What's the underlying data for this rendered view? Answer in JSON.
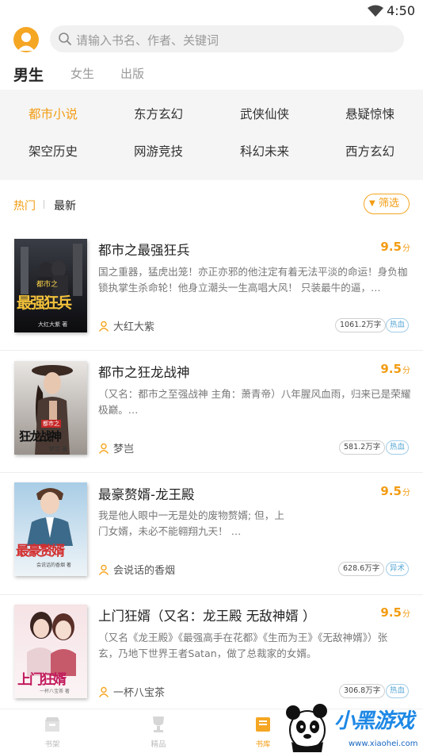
{
  "status_bar": {
    "time": "4:50"
  },
  "search": {
    "placeholder": "请输入书名、作者、关键词"
  },
  "gender_tabs": [
    {
      "label": "男生",
      "active": true
    },
    {
      "label": "女生",
      "active": false
    },
    {
      "label": "出版",
      "active": false
    }
  ],
  "categories": [
    {
      "label": "都市小说",
      "active": true
    },
    {
      "label": "东方玄幻"
    },
    {
      "label": "武侠仙侠"
    },
    {
      "label": "悬疑惊悚"
    },
    {
      "label": "架空历史"
    },
    {
      "label": "网游竞技"
    },
    {
      "label": "科幻未来"
    },
    {
      "label": "西方玄幻"
    }
  ],
  "filter": {
    "hot": "热门",
    "new": "最新",
    "button": "筛选"
  },
  "books": [
    {
      "title": "都市之最强狂兵",
      "score": "9.5",
      "score_unit": "分",
      "desc": "国之重器，猛虎出笼！亦正亦邪的他注定有着无法平淡的命运！身负枷锁执掌生杀命轮！他身立潮头一生高唱大风！ 只装最牛的逼，…",
      "author": "大红大紫",
      "word_count": "1061.2万字",
      "tag": "热血",
      "cover_text": "最强狂兵",
      "cover_top": "都市之",
      "cover_author": "大红大紫 著"
    },
    {
      "title": "都市之狂龙战神",
      "score": "9.5",
      "score_unit": "分",
      "desc": "（又名：都市之至强战神 主角：萧青帝）八年腥风血雨，归来已是荣耀极巅。…",
      "author": "梦岂",
      "word_count": "581.2万字",
      "tag": "热血",
      "cover_text": "狂龙战神",
      "cover_top": "都市之",
      "cover_author": "梦岂 著"
    },
    {
      "title": "最豪赘婿-龙王殿",
      "score": "9.5",
      "score_unit": "分",
      "desc": "我是他人眼中一无是处的废物赘婿; 但，上门女婿，未必不能翱翔九天！ …",
      "author": "会说话的香烟",
      "word_count": "628.6万字",
      "tag": "异术",
      "cover_text": "最豪赘婿",
      "cover_top": "",
      "cover_author": "会说话的香烟 著"
    },
    {
      "title": "上门狂婿（又名：龙王殿 无敌神婿 ）",
      "score": "9.5",
      "score_unit": "分",
      "desc": "（又名《龙王殿》《最强高手在花都》《生而为王》《无敌神婿》）张玄，乃地下世界王者Satan，做了总裁家的女婿。",
      "author": "一杯八宝茶",
      "word_count": "306.8万字",
      "tag": "热血",
      "cover_text": "上门狂婿",
      "cover_top": "",
      "cover_author": "一杯八宝茶 著"
    }
  ],
  "bottom_nav": [
    {
      "label": "书架",
      "icon": "bookshelf-icon"
    },
    {
      "label": "精品",
      "icon": "trophy-icon"
    },
    {
      "label": "书库",
      "icon": "library-icon",
      "active": true
    }
  ],
  "watermark": {
    "brand": "小黑游戏",
    "url": "www.xiaohei.com"
  },
  "colors": {
    "accent": "#f39c12",
    "tag_blue": "#5aa9d6",
    "panel_bg": "#f5f5f5"
  }
}
